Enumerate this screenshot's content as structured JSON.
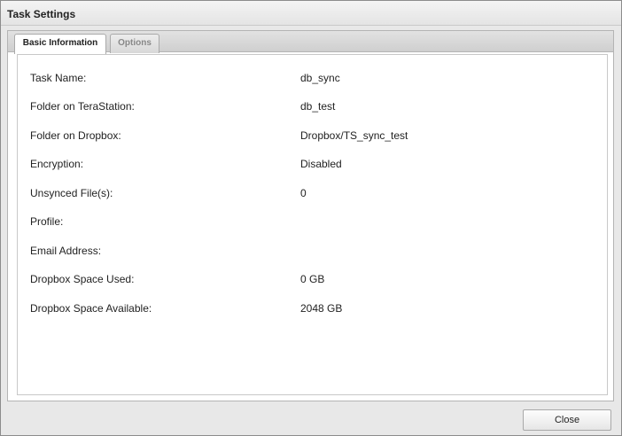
{
  "dialog": {
    "title": "Task Settings"
  },
  "tabs": [
    {
      "label": "Basic Information",
      "active": true
    },
    {
      "label": "Options",
      "active": false
    }
  ],
  "fields": [
    {
      "label": "Task Name:",
      "value": "db_sync"
    },
    {
      "label": "Folder on TeraStation:",
      "value": "db_test"
    },
    {
      "label": "Folder on Dropbox:",
      "value": "Dropbox/TS_sync_test"
    },
    {
      "label": "Encryption:",
      "value": "Disabled"
    },
    {
      "label": "Unsynced File(s):",
      "value": "0"
    },
    {
      "label": "Profile:",
      "value": ""
    },
    {
      "label": "Email Address:",
      "value": ""
    },
    {
      "label": "Dropbox Space Used:",
      "value": "0 GB"
    },
    {
      "label": "Dropbox Space Available:",
      "value": "2048 GB"
    }
  ],
  "footer": {
    "close_label": "Close"
  }
}
